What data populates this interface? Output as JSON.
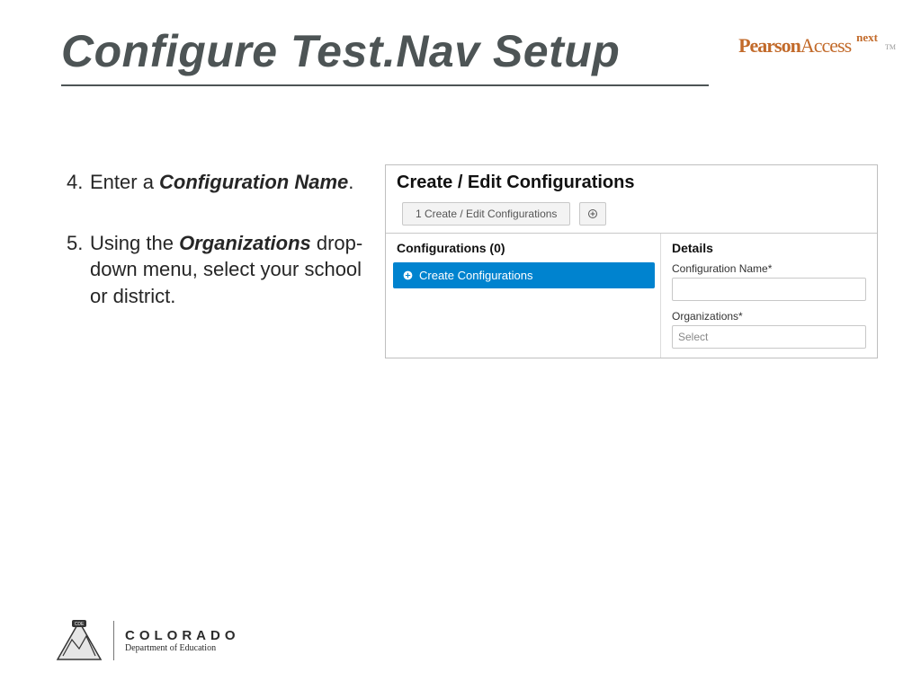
{
  "title": "Configure Test.Nav Setup",
  "brand": {
    "t1": "Pearson",
    "t2": "Access",
    "t3": "next",
    "tm": "TM"
  },
  "steps": {
    "s4": {
      "num": "4.",
      "pre": "Enter a ",
      "bi": "Configuration Name",
      "post": "."
    },
    "s5": {
      "num": "5.",
      "pre": "Using the ",
      "bi": "Organizations",
      "post": " drop-down menu, select your school or district."
    }
  },
  "panel": {
    "title": "Create / Edit Configurations",
    "crumb": "1 Create / Edit Configurations",
    "left_hdr": "Configurations (0)",
    "right_hdr": "Details",
    "bluebar": "Create Configurations",
    "field_name_lbl": "Configuration Name*",
    "field_org_lbl": "Organizations*",
    "org_placeholder": "Select"
  },
  "footer": {
    "cde_tag": "CDE",
    "l1": "COLORADO",
    "l2": "Department of Education"
  }
}
